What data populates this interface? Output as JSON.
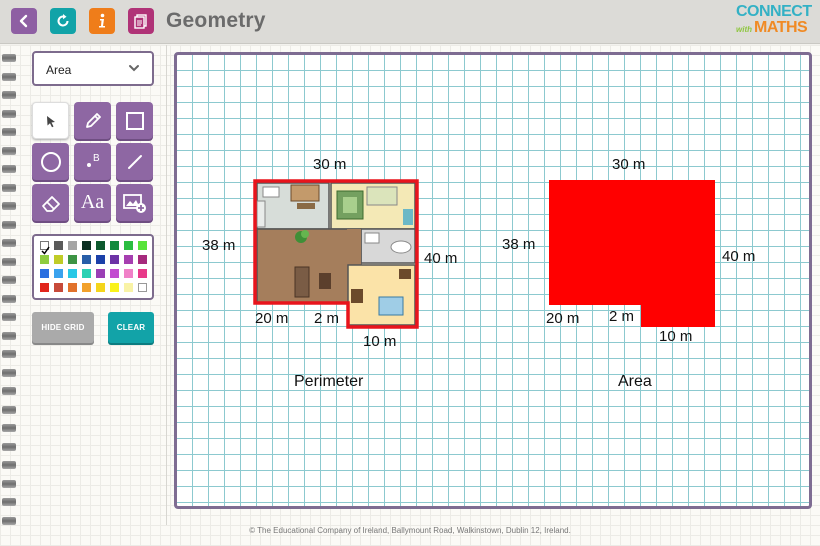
{
  "header": {
    "title": "Geometry",
    "logo": {
      "line1": "CONNECT",
      "line2": "with",
      "line3": "MATHS"
    },
    "buttons": [
      {
        "name": "back-button",
        "icon": "chevron-left-icon",
        "color": "#8e5fa3"
      },
      {
        "name": "refresh-button",
        "icon": "refresh-icon",
        "color": "#12a3a8"
      },
      {
        "name": "info-button",
        "icon": "info-icon",
        "color": "#ef7d1a"
      },
      {
        "name": "notes-button",
        "icon": "document-icon",
        "color": "#b03377"
      }
    ]
  },
  "sidebar": {
    "mode_select": {
      "value": "Area",
      "icon": "chevron-down-icon"
    },
    "tools": [
      {
        "name": "select-tool",
        "icon": "arrow-cursor-icon"
      },
      {
        "name": "pencil-tool",
        "icon": "pencil-icon"
      },
      {
        "name": "rectangle-tool",
        "icon": "square-icon"
      },
      {
        "name": "circle-tool",
        "icon": "circle-icon"
      },
      {
        "name": "point-tool",
        "icon": "point-label-icon",
        "glyph": "B"
      },
      {
        "name": "line-tool",
        "icon": "line-icon"
      },
      {
        "name": "eraser-tool",
        "icon": "eraser-icon"
      },
      {
        "name": "text-tool",
        "icon": "text-icon",
        "glyph": "Aa"
      },
      {
        "name": "image-tool",
        "icon": "add-image-icon"
      }
    ],
    "palette": {
      "colors": [
        "none",
        "#5a5a5a",
        "#a5a5a5",
        "#0b2f22",
        "#0d5a2f",
        "#118a3e",
        "#2bbd41",
        "#57e33a",
        "#8ecc3f",
        "#c0cc27",
        "#3d9444",
        "#285ea8",
        "#1b40a9",
        "#6d33a6",
        "#a63fb0",
        "#a62a7d",
        "#2a6ee0",
        "#3aa2ee",
        "#28c8e6",
        "#2bd1b3",
        "#9a3fb5",
        "#c24bd0",
        "#f081c8",
        "#e83a8a",
        "#e1261c",
        "#c74a3a",
        "#e1722c",
        "#f2a12c",
        "#f4d51c",
        "#f9f21c",
        "#f9f3a6",
        "#ffffff"
      ]
    },
    "hide_grid_label": "HIDE GRID",
    "clear_label": "CLEAR",
    "hide_grid_color": "#aaaaaa",
    "clear_color": "#12a3a8"
  },
  "board": {
    "perimeter": {
      "caption": "Perimeter",
      "labels": {
        "top": "30 m",
        "left": "38 m",
        "right": "40 m",
        "bottom_left": "20 m",
        "notch": "2 m",
        "bottom_right": "10 m"
      },
      "outline_color": "#e8141c"
    },
    "area": {
      "caption": "Area",
      "labels": {
        "top": "30 m",
        "left": "38 m",
        "right": "40 m",
        "bottom_left": "20 m",
        "notch": "2 m",
        "bottom_right": "10 m"
      },
      "fill_color": "#ff0000"
    }
  },
  "footer": {
    "copyright": "© The Educational Company of Ireland, Ballymount Road, Walkinstown, Dublin 12, Ireland."
  }
}
